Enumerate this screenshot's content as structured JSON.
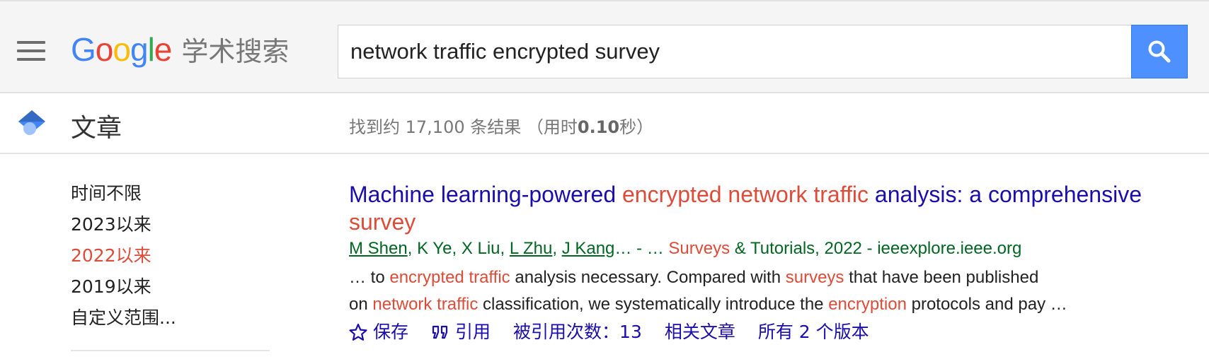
{
  "header": {
    "logo_google": [
      "G",
      "o",
      "o",
      "g",
      "l",
      "e"
    ],
    "logo_sub": "学术搜索",
    "search_value": "network traffic encrypted survey",
    "icons": {
      "menu": "hamburger-menu-icon",
      "search": "search-icon"
    }
  },
  "subbar": {
    "title": "文章",
    "stats_prefix": "找到约 17,100 条结果 （用时",
    "stats_time": "0.10",
    "stats_suffix": "秒）",
    "icon": "graduation-cap-icon"
  },
  "sidebar": {
    "items": [
      {
        "label": "时间不限",
        "active": false
      },
      {
        "label": "2023以来",
        "active": false
      },
      {
        "label": "2022以来",
        "active": true
      },
      {
        "label": "2019以来",
        "active": false
      },
      {
        "label": "自定义范围...",
        "active": false
      }
    ]
  },
  "result": {
    "title_parts": [
      {
        "text": "Machine learning-powered ",
        "hl": false
      },
      {
        "text": "encrypted network traffic",
        "hl": true
      },
      {
        "text": " analysis: a comprehensive ",
        "hl": false
      },
      {
        "text": "survey",
        "hl": true
      }
    ],
    "authors": [
      {
        "name": "M Shen",
        "link": true
      },
      {
        "name": "K Ye",
        "link": false
      },
      {
        "name": "X Liu",
        "link": false
      },
      {
        "name": "L Zhu",
        "link": true
      },
      {
        "name": "J Kang",
        "link": true
      }
    ],
    "meta_after_authors": "… - … ",
    "meta_venue_hl": "Surveys",
    "meta_venue_rest": " & Tutorials, 2022 - ieeexplore.ieee.org",
    "snippet_lines": [
      [
        {
          "text": "… to ",
          "hl": false
        },
        {
          "text": "encrypted traffic",
          "hl": true
        },
        {
          "text": " analysis necessary. Compared with ",
          "hl": false
        },
        {
          "text": "surveys",
          "hl": true
        },
        {
          "text": " that have been published",
          "hl": false
        }
      ],
      [
        {
          "text": "on ",
          "hl": false
        },
        {
          "text": "network traffic",
          "hl": true
        },
        {
          "text": " classification, we systematically introduce the ",
          "hl": false
        },
        {
          "text": "encryption",
          "hl": true
        },
        {
          "text": " protocols and pay …",
          "hl": false
        }
      ]
    ],
    "actions": {
      "save": "保存",
      "cite": "引用",
      "cited_by": "被引用次数：13",
      "related": "相关文章",
      "versions": "所有 2 个版本"
    }
  },
  "colors": {
    "link_blue": "#1a0dab",
    "highlight_red": "#dd4b39",
    "meta_green": "#006621",
    "search_button_blue": "#4d90fe"
  }
}
